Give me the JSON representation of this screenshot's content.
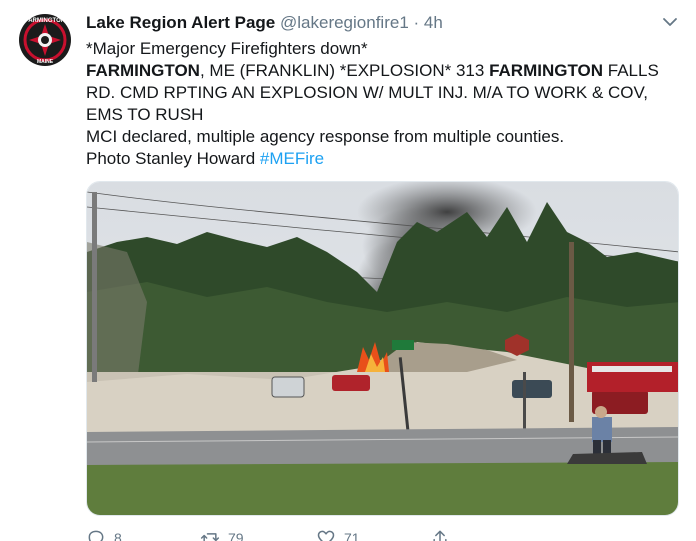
{
  "tweet": {
    "display_name": "Lake Region Alert Page",
    "handle": "@lakeregionfire1",
    "separator": "·",
    "time": "4h",
    "avatar": {
      "top_text": "FARMINGTON",
      "bottom_text": "MAINE"
    },
    "body": {
      "line1": "*Major Emergency Firefighters down*",
      "line2_bold1": "FARMINGTON",
      "line2_rest1": ", ME (FRANKLIN) *EXPLOSION* 313 ",
      "line2_bold2": "FARMINGTON",
      "line2_rest2": " FALLS",
      "line3": "RD. CMD RPTING AN EXPLOSION W/ MULT INJ. M/A TO WORK & COV,",
      "line4": "EMS TO RUSH",
      "line5": "MCI declared, multiple agency response from multiple counties.",
      "line6_text": "Photo Stanley Howard ",
      "line6_hashtag": "#MEFire"
    },
    "actions": {
      "reply_count": "8",
      "retweet_count": "79",
      "like_count": "71"
    },
    "colors": {
      "link": "#1da1f2",
      "secondary_text": "#657786",
      "primary_text": "#14171a",
      "fire": "#e8501a",
      "smoke": "#3a3a3a"
    },
    "icons": [
      "reply-icon",
      "retweet-icon",
      "like-icon",
      "share-icon",
      "chevron-down-icon"
    ]
  }
}
